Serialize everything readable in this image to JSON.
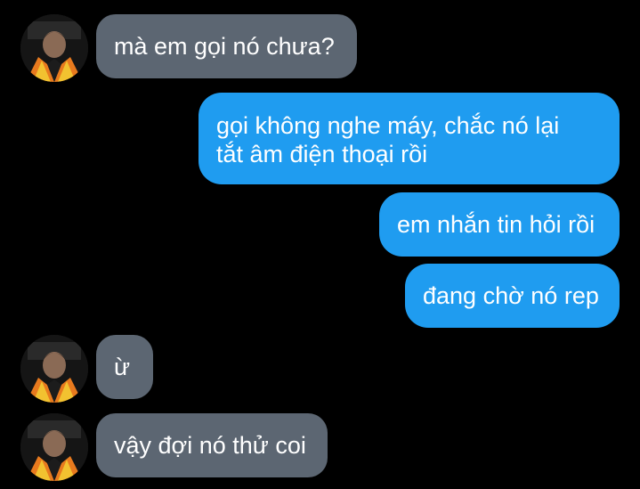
{
  "colors": {
    "background": "#000000",
    "incoming_bubble": "#5c6672",
    "outgoing_bubble": "#1f9cf0",
    "text": "#ffffff"
  },
  "messages": [
    {
      "direction": "incoming",
      "text": "mà em gọi nó chưa?",
      "avatar_icon": "profile-photo-icon"
    },
    {
      "direction": "outgoing",
      "lines": [
        "gọi không nghe máy, chắc nó lại",
        "tắt âm điện thoại rồi"
      ]
    },
    {
      "direction": "outgoing",
      "text": "em nhắn tin hỏi rồi"
    },
    {
      "direction": "outgoing",
      "text": "đang chờ nó rep"
    },
    {
      "direction": "incoming",
      "text": "ừ",
      "avatar_icon": "profile-photo-icon"
    },
    {
      "direction": "incoming",
      "text": "vậy đợi nó thử coi",
      "avatar_icon": "profile-photo-icon"
    }
  ]
}
